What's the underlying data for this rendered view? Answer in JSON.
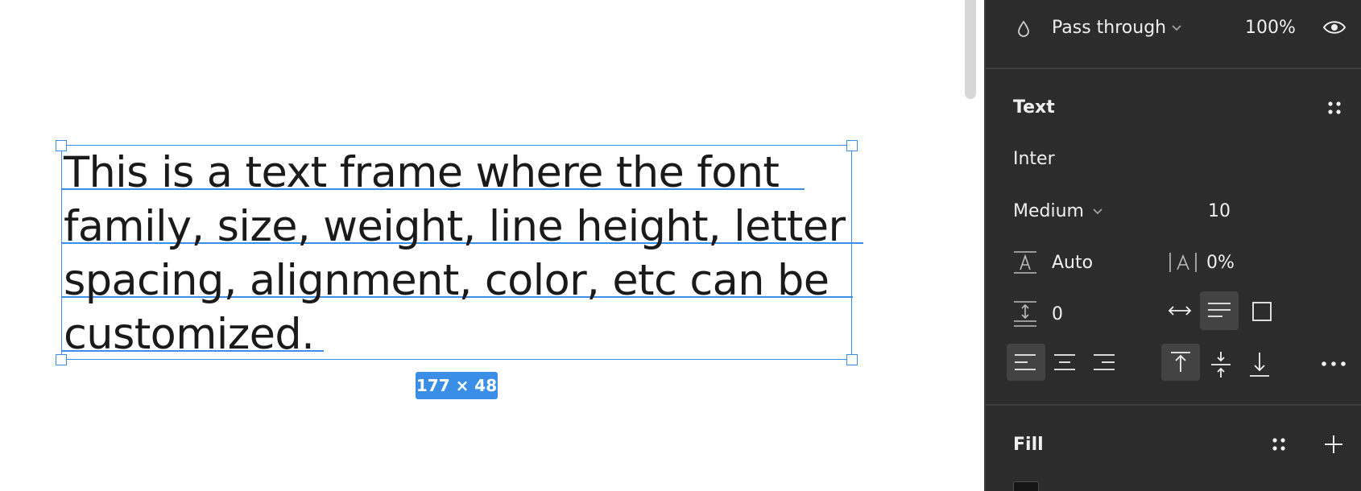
{
  "canvas": {
    "text_lines": [
      "This is a text frame where the font",
      "family, size, weight, line height, letter",
      "spacing, alignment, color, etc can be",
      "customized."
    ],
    "size_badge": "177 × 48"
  },
  "panel": {
    "layer": {
      "blend_mode": "Pass through",
      "opacity": "100%"
    },
    "text_section": {
      "title": "Text",
      "font_family": "Inter",
      "font_weight": "Medium",
      "font_size": "10",
      "line_height": "Auto",
      "letter_spacing": "0%",
      "paragraph_spacing": "0"
    },
    "fill_section": {
      "title": "Fill"
    }
  },
  "colors": {
    "selection": "#3a8ee6",
    "panel_bg": "#2c2c2c",
    "text": "#1a1a1a"
  },
  "icons": [
    "drop-icon",
    "chevron-down-icon",
    "eye-icon",
    "styles-grid-icon",
    "line-height-icon",
    "letter-spacing-icon",
    "paragraph-spacing-icon",
    "auto-width-icon",
    "auto-height-icon",
    "fixed-size-icon",
    "align-left-icon",
    "align-center-icon",
    "align-right-icon",
    "align-top-icon",
    "align-middle-icon",
    "align-bottom-icon",
    "more-icon",
    "plus-icon"
  ]
}
